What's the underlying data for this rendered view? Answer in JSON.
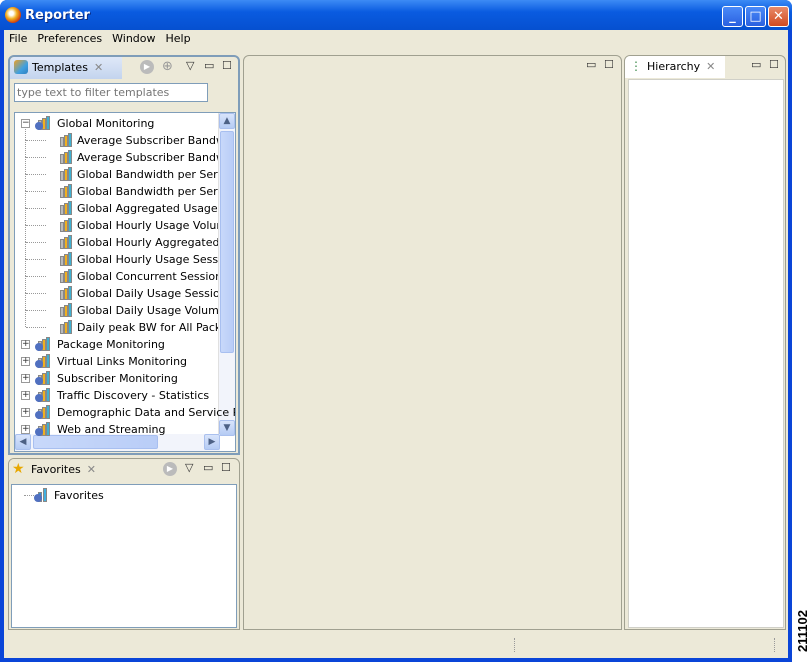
{
  "window": {
    "title": "Reporter",
    "minimize": "_",
    "maximize": "□",
    "close": "✕"
  },
  "menu": [
    "File",
    "Preferences",
    "Window",
    "Help"
  ],
  "templates": {
    "tab_label": "Templates",
    "filter_placeholder": "type text to filter templates",
    "tree": [
      {
        "label": "Global Monitoring",
        "expanded": true,
        "children": [
          "Average Subscriber Bandwidt",
          "Average Subscriber Bandwidt",
          "Global Bandwidth per Service",
          "Global Bandwidth per Service",
          "Global Aggregated Usage Vol",
          "Global Hourly Usage Volume p",
          "Global Hourly Aggregated Mir",
          "Global Hourly Usage Sessions",
          "Global Concurrent Sessions p",
          "Global Daily Usage Sessions p",
          "Global Daily Usage Volume pe",
          "Daily peak BW for All Package"
        ]
      },
      {
        "label": "Package Monitoring",
        "expanded": false
      },
      {
        "label": "Virtual Links Monitoring",
        "expanded": false
      },
      {
        "label": "Subscriber Monitoring",
        "expanded": false
      },
      {
        "label": "Traffic Discovery - Statistics",
        "expanded": false
      },
      {
        "label": "Demographic Data and Service Pc",
        "expanded": false
      },
      {
        "label": "Web and Streaming",
        "expanded": false
      }
    ]
  },
  "favorites": {
    "tab_label": "Favorites",
    "items": [
      "Favorites"
    ]
  },
  "hierarchy": {
    "tab_label": "Hierarchy"
  },
  "figure_number": "211102",
  "colors": {
    "title_bar": "#0a5be0",
    "panel_bg": "#ece9d8",
    "active_tab": "#c3d4ee"
  }
}
